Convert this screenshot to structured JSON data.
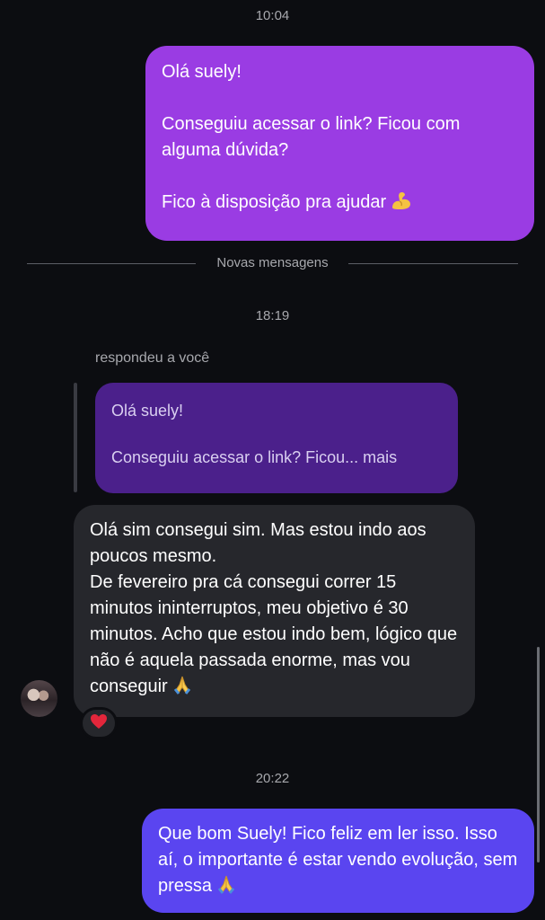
{
  "thread": {
    "time_1": "10:04",
    "message_1": {
      "line_1": "Olá suely!",
      "line_2": "Conseguiu acessar o link? Ficou com alguma dúvida?",
      "line_3": "Fico à disposição pra ajudar",
      "emoji": "flexed-biceps-icon"
    },
    "divider_label": "Novas mensagens",
    "time_2": "18:19",
    "reply_caption": "respondeu a você",
    "quoted": {
      "line_1": "Olá suely!",
      "line_2": "Conseguiu acessar o link? Ficou... mais"
    },
    "message_2": {
      "line_1": "Olá sim consegui sim. Mas estou indo aos poucos mesmo.",
      "line_2": "De fevereiro pra cá consegui correr 15 minutos ininterruptos, meu objetivo é 30 minutos. Acho que estou indo bem, lógico que não é aquela passada enorme, mas vou conseguir",
      "emoji": "folded-hands-icon",
      "reaction": "heart-icon"
    },
    "time_3": "20:22",
    "message_3": {
      "text": "Que bom Suely! Fico feliz em ler isso. Isso aí, o importante é estar vendo evolução, sem pressa",
      "emoji": "folded-hands-icon"
    }
  },
  "colors": {
    "background": "#0c0d11",
    "outgoing_1": "#9a3ce3",
    "outgoing_2": "#5a45f0",
    "quoted": "#4b208b",
    "incoming": "#26272c",
    "meta_text": "#a7a8ad"
  }
}
